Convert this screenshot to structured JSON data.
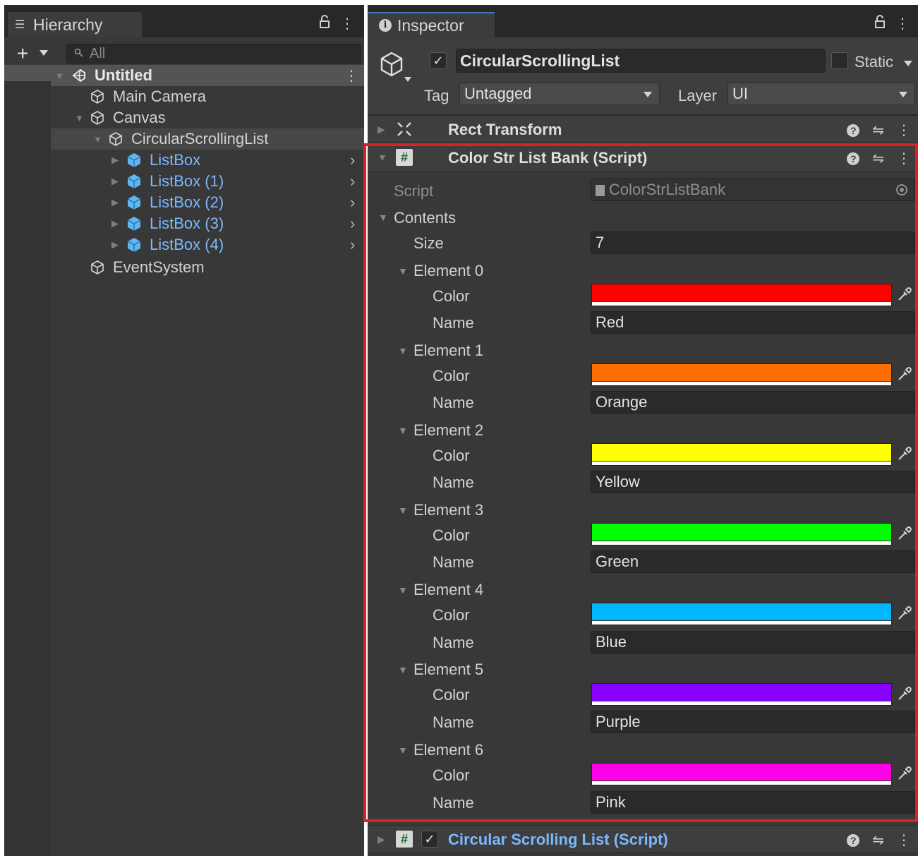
{
  "hierarchy": {
    "tab_label": "Hierarchy",
    "search_placeholder": "All",
    "tree": [
      {
        "label": "Untitled",
        "icon": "unity-scene-icon"
      },
      {
        "label": "Main Camera",
        "icon": "gameobject-icon"
      },
      {
        "label": "Canvas",
        "icon": "gameobject-icon"
      },
      {
        "label": "CircularScrollingList",
        "icon": "gameobject-icon"
      },
      {
        "label": "ListBox",
        "icon": "prefab-icon"
      },
      {
        "label": "ListBox (1)",
        "icon": "prefab-icon"
      },
      {
        "label": "ListBox (2)",
        "icon": "prefab-icon"
      },
      {
        "label": "ListBox (3)",
        "icon": "prefab-icon"
      },
      {
        "label": "ListBox (4)",
        "icon": "prefab-icon"
      },
      {
        "label": "EventSystem",
        "icon": "gameobject-icon"
      }
    ]
  },
  "inspector": {
    "tab_label": "Inspector",
    "object_name": "CircularScrollingList",
    "static_label": "Static",
    "tag_label": "Tag",
    "tag_value": "Untagged",
    "layer_label": "Layer",
    "layer_value": "UI",
    "components": {
      "rect_transform": "Rect Transform",
      "color_bank": "Color Str List Bank (Script)",
      "circular_list": "Circular Scrolling List (Script)"
    },
    "script_label": "Script",
    "script_value": "ColorStrListBank",
    "contents_label": "Contents",
    "size_label": "Size",
    "size_value": "7",
    "color_label": "Color",
    "name_label": "Name",
    "elements": [
      {
        "label": "Element 0",
        "color": "#ff0000",
        "name": "Red"
      },
      {
        "label": "Element 1",
        "color": "#ff6e00",
        "name": "Orange"
      },
      {
        "label": "Element 2",
        "color": "#ffff00",
        "name": "Yellow"
      },
      {
        "label": "Element 3",
        "color": "#00ff00",
        "name": "Green"
      },
      {
        "label": "Element 4",
        "color": "#00b7ff",
        "name": "Blue"
      },
      {
        "label": "Element 5",
        "color": "#8800ff",
        "name": "Purple"
      },
      {
        "label": "Element 6",
        "color": "#ff00e6",
        "name": "Pink"
      }
    ]
  },
  "colors": {
    "highlight_frame": "#e01e26",
    "prefab_blue": "#7cb9ff"
  }
}
